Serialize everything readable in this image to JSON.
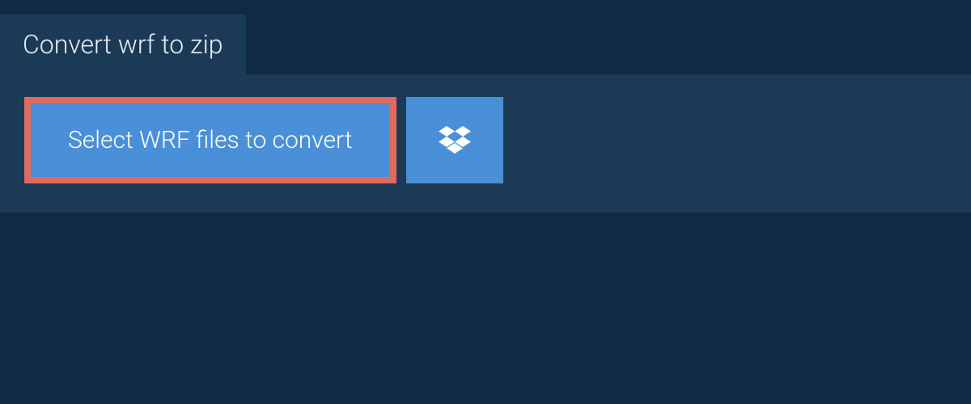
{
  "tab": {
    "title": "Convert wrf to zip"
  },
  "actions": {
    "select_label": "Select WRF files to convert"
  },
  "colors": {
    "background_dark": "#102a43",
    "panel": "#1b3a56",
    "button_primary": "#4a90d9",
    "highlight_border": "#e06a5f",
    "text_light": "#ffffff"
  }
}
